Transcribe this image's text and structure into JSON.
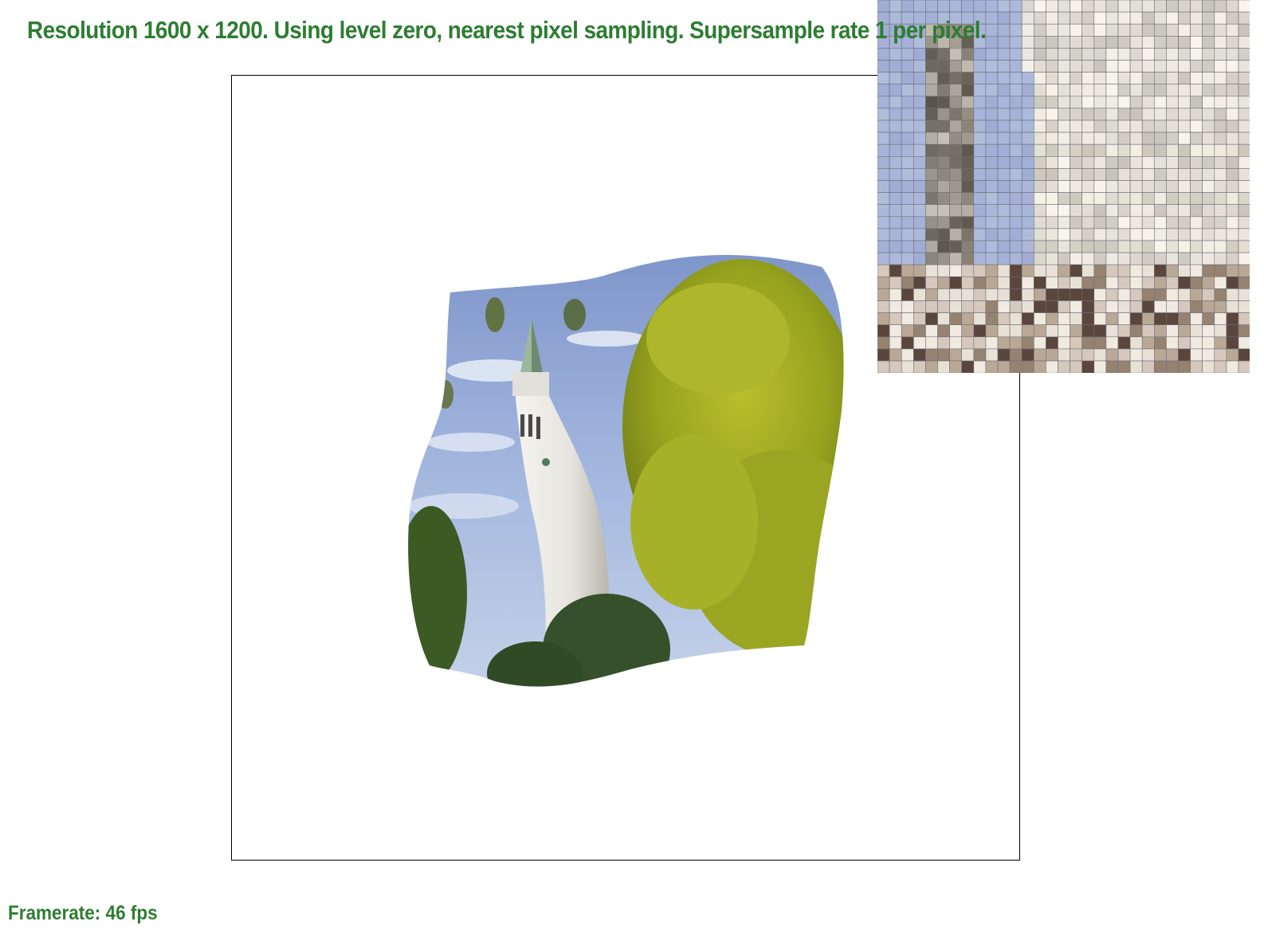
{
  "status": {
    "title": "Resolution 1600 x 1200. Using level zero, nearest pixel sampling. Supersample rate 1 per pixel.",
    "title_color": "#2e7d32"
  },
  "footer": {
    "framerate_label": "Framerate: 46 fps",
    "color": "#2e7d32"
  },
  "viewport": {
    "background": "#ffffff",
    "border_color": "#000000",
    "image_subject": "warped-tower-photo"
  },
  "zoom_inset": {
    "grid_color": "#6e6e78",
    "sky_color": "#a8b2d6"
  },
  "colors": {
    "sky": "#8fa6d6",
    "cloud": "#e8eef8",
    "tower": "#ececea",
    "tower_shade": "#c9c7c0",
    "foliage_yellow": "#a8b022",
    "foliage_dark": "#3f5a22"
  }
}
